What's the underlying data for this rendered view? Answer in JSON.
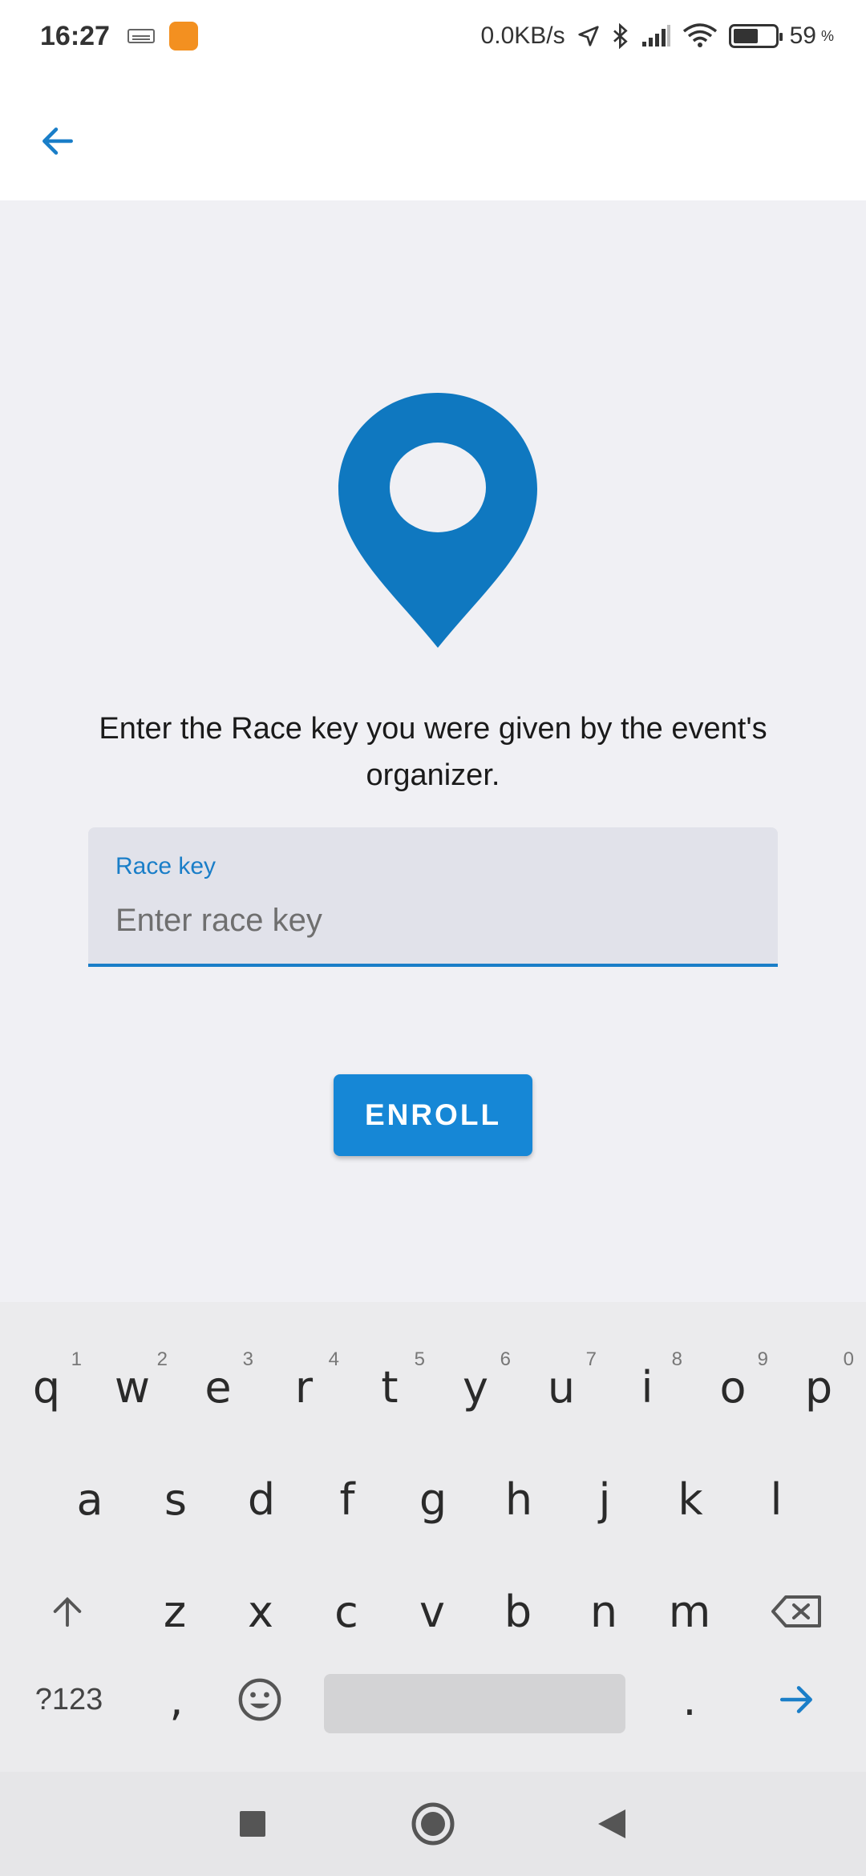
{
  "status_bar": {
    "time": "16:27",
    "network_speed": "0.0KB/s",
    "battery_percent": "59",
    "battery_unit": "%",
    "icons": [
      "keyboard-icon",
      "app-badge-icon",
      "location-arrow-icon",
      "bluetooth-icon",
      "signal-icon",
      "wifi-icon",
      "battery-icon"
    ]
  },
  "app_bar": {
    "back_icon": "arrow-left-icon"
  },
  "main": {
    "prompt": "Enter the Race key you were given by the event's organizer.",
    "race_key_field": {
      "label": "Race key",
      "placeholder": "Enter race key",
      "value": ""
    },
    "enroll_button": "ENROLL"
  },
  "keyboard": {
    "row1": [
      {
        "k": "q",
        "h": "1"
      },
      {
        "k": "w",
        "h": "2"
      },
      {
        "k": "e",
        "h": "3"
      },
      {
        "k": "r",
        "h": "4"
      },
      {
        "k": "t",
        "h": "5"
      },
      {
        "k": "y",
        "h": "6"
      },
      {
        "k": "u",
        "h": "7"
      },
      {
        "k": "i",
        "h": "8"
      },
      {
        "k": "o",
        "h": "9"
      },
      {
        "k": "p",
        "h": "0"
      }
    ],
    "row2": [
      "a",
      "s",
      "d",
      "f",
      "g",
      "h",
      "j",
      "k",
      "l"
    ],
    "row3": [
      "z",
      "x",
      "c",
      "v",
      "b",
      "n",
      "m"
    ],
    "symbols_key": "?123",
    "comma_key": ",",
    "period_key": "."
  },
  "colors": {
    "accent": "#1687d6",
    "pin": "#0f78c0",
    "background": "#f0f0f4"
  }
}
